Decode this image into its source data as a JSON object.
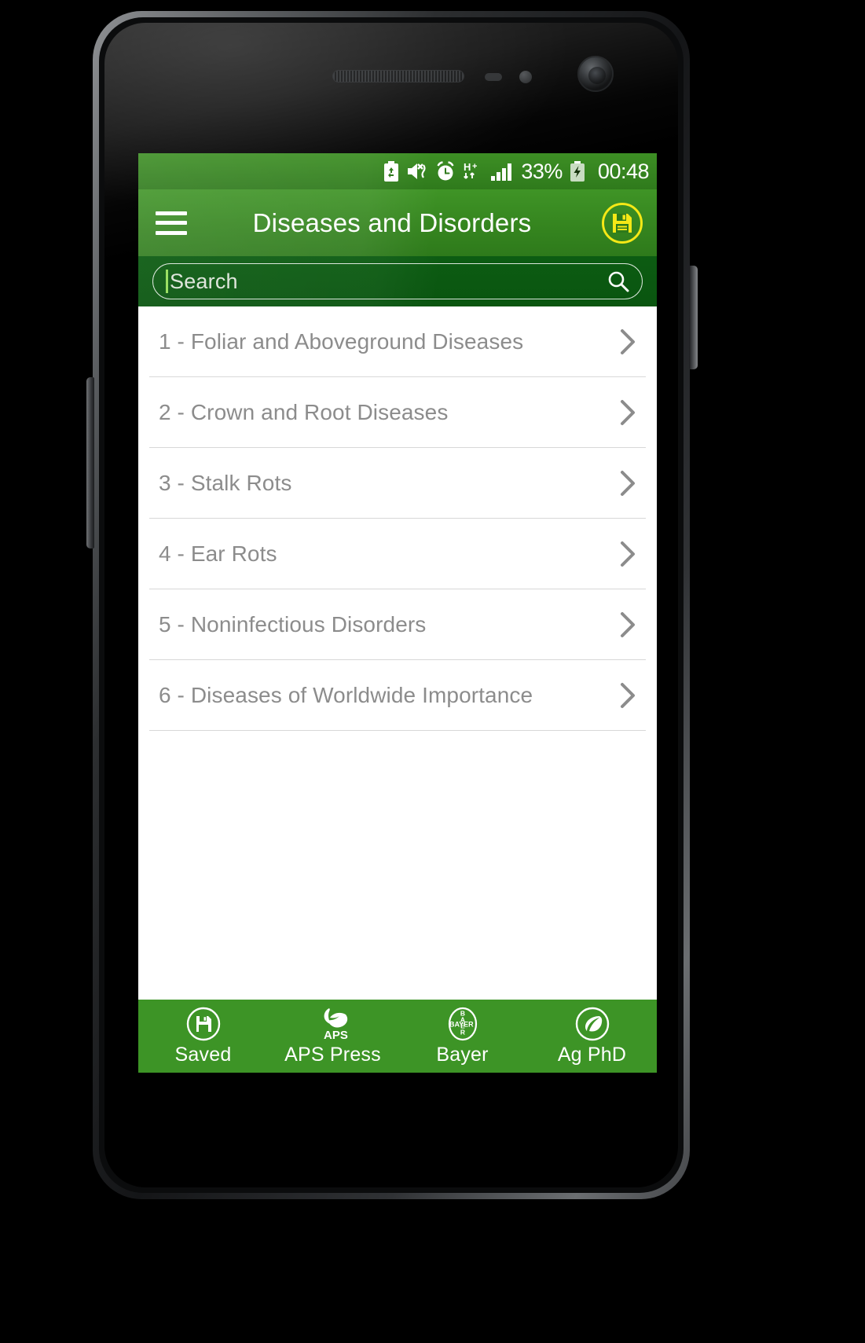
{
  "statusbar": {
    "icons": [
      "battery-saver-icon",
      "mute-vibrate-icon",
      "alarm-clock-icon",
      "hsdpa-data-icon",
      "signal-bars-icon"
    ],
    "battery_percent": "33%",
    "battery_icon": "charging-battery-icon",
    "time": "00:48"
  },
  "appbar": {
    "menu_icon": "hamburger-menu-icon",
    "title": "Diseases and Disorders",
    "save_icon": "floppy-save-icon"
  },
  "search": {
    "placeholder": "Search",
    "value": "",
    "icon": "search-magnifier-icon"
  },
  "list": {
    "items": [
      {
        "label": "1 - Foliar and Aboveground Diseases",
        "chevron": "chevron-right-icon"
      },
      {
        "label": "2 - Crown and Root Diseases",
        "chevron": "chevron-right-icon"
      },
      {
        "label": "3 - Stalk Rots",
        "chevron": "chevron-right-icon"
      },
      {
        "label": "4 - Ear Rots",
        "chevron": "chevron-right-icon"
      },
      {
        "label": "5 - Noninfectious Disorders",
        "chevron": "chevron-right-icon"
      },
      {
        "label": "6 - Diseases of Worldwide Importance",
        "chevron": "chevron-right-icon"
      }
    ]
  },
  "bottomnav": {
    "items": [
      {
        "label": "Saved",
        "icon": "floppy-disk-circle-icon"
      },
      {
        "label": "APS Press",
        "icon": "aps-press-leaf-logo-icon",
        "logo_text": "APS"
      },
      {
        "label": "Bayer",
        "icon": "bayer-cross-logo-icon",
        "logo_text": "BAYER"
      },
      {
        "label": "Ag PhD",
        "icon": "ag-phd-leaf-circle-icon"
      }
    ]
  },
  "colors": {
    "header_green": "#3d9426",
    "search_green": "#0c5c12",
    "nav_green": "#3d9426",
    "accent_yellow": "#f5e816",
    "list_text": "#8c8c8c"
  }
}
